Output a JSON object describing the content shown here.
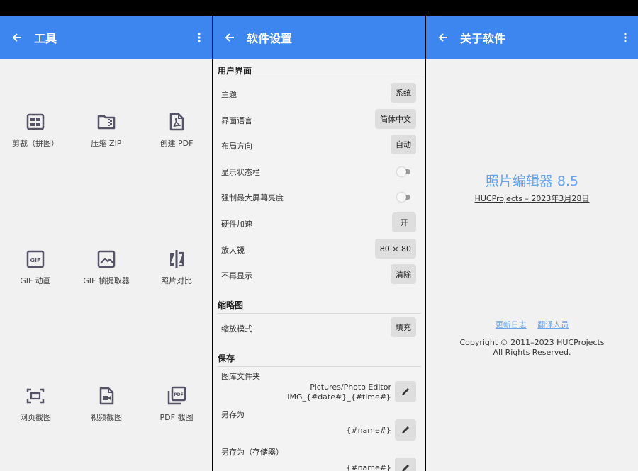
{
  "tools_screen": {
    "title": "工具",
    "tools": [
      {
        "label": "剪裁（拼图）",
        "icon": "grid-icon"
      },
      {
        "label": "压缩 ZIP",
        "icon": "zip-folder-icon"
      },
      {
        "label": "创建 PDF",
        "icon": "pdf-file-icon"
      },
      {
        "label": "GIF 动画",
        "icon": "gif-icon"
      },
      {
        "label": "GIF 帧提取器",
        "icon": "image-icon"
      },
      {
        "label": "照片对比",
        "icon": "compare-icon"
      },
      {
        "label": "网页截图",
        "icon": "web-capture-icon"
      },
      {
        "label": "视频截图",
        "icon": "video-file-icon"
      },
      {
        "label": "PDF 截图",
        "icon": "pdf-stack-icon"
      }
    ]
  },
  "settings_screen": {
    "title": "软件设置",
    "ui_section": "用户界面",
    "theme": {
      "label": "主题",
      "value": "系统"
    },
    "language": {
      "label": "界面语言",
      "value": "简体中文"
    },
    "layout": {
      "label": "布局方向",
      "value": "自动"
    },
    "status_bar": {
      "label": "显示状态栏",
      "on": false
    },
    "max_brightness": {
      "label": "强制最大屏幕亮度",
      "on": false
    },
    "hw_accel": {
      "label": "硬件加速",
      "value": "开"
    },
    "magnifier": {
      "label": "放大镜",
      "value": "80 × 80"
    },
    "dont_show": {
      "label": "不再显示",
      "value": "清除"
    },
    "thumb_section": "缩略图",
    "scale_mode": {
      "label": "缩放模式",
      "value": "填充"
    },
    "save_section": "保存",
    "gallery_folder": {
      "label": "图库文件夹",
      "line1": "Pictures/Photo Editor",
      "line2": "IMG_{#date#}_{#time#}"
    },
    "save_as": {
      "label": "另存为",
      "value": "{#name#}"
    },
    "save_as_storage": {
      "label": "另存为（存储器）",
      "value": "{#name#}"
    }
  },
  "about_screen": {
    "title": "关于软件",
    "app_name": "照片编辑器 8.5",
    "subtitle": "HUCProjects – 2023年3月28日",
    "changelog": "更新日志",
    "translators": "翻译人员",
    "copyright": "Copyright © 2011–2023 HUCProjects",
    "rights": "All Rights Reserved."
  },
  "colors": {
    "appbar": "#3d86f0",
    "link": "#6aa6ee"
  }
}
